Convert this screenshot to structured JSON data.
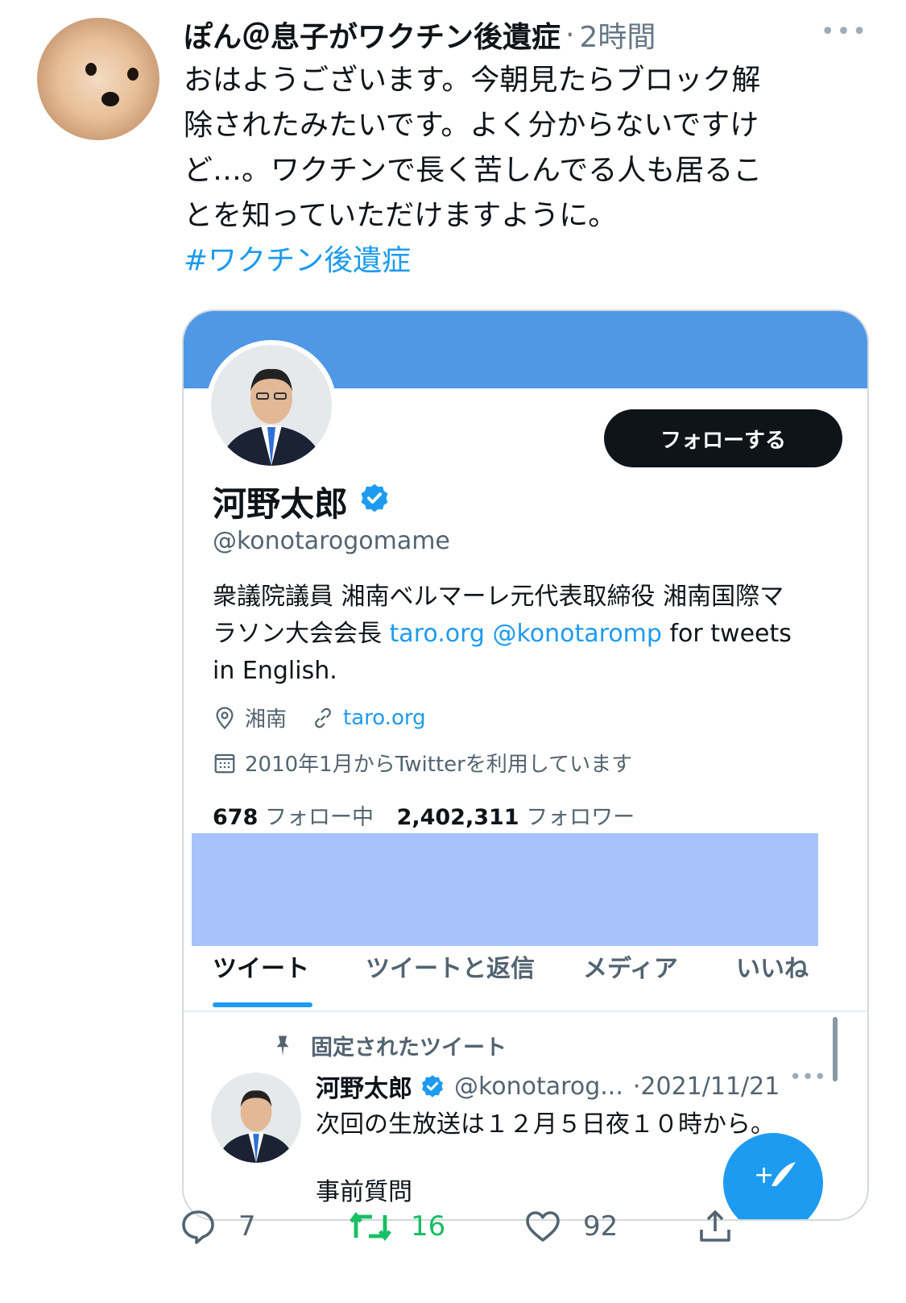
{
  "tweet": {
    "author_name": "ぽん＠息子がワクチン後遺症",
    "separator": "·",
    "time": "2時間",
    "text_lines": [
      "おはようございます。今朝見たらブロック解",
      "除されたみたいです。よく分からないですけ",
      "ど…。ワクチンで長く苦しんでる人も居るこ",
      "とを知っていただけますように。"
    ],
    "hashtag": "#ワクチン後遺症"
  },
  "card": {
    "follow_button": "フォローする",
    "name": "河野太郎",
    "handle": "@konotarogomame",
    "bio_lines": {
      "line1": "衆議院議員 湘南ベルマーレ元代表取締役 湘南国際マ",
      "line2_prefix": "ラソン大会会長 ",
      "line2_link1": "taro.org",
      "line2_link2": "@konotaromp",
      "line2_suffix": " for tweets",
      "line3": "in English."
    },
    "location": "湘南",
    "website": "taro.org",
    "joined": "2010年1月からTwitterを利用しています",
    "following_count": "678",
    "following_label": "フォロー中",
    "followers_count": "2,402,311",
    "followers_label": "フォロワー",
    "tabs": [
      "ツイート",
      "ツイートと返信",
      "メディア",
      "いいね"
    ],
    "pinned_label": "固定されたツイート",
    "pinned_tweet": {
      "name": "河野太郎",
      "handle": "@konotarog...",
      "date": "·2021/11/21",
      "text": "次回の生放送は１２月５日夜１０時から。",
      "text2": "事前質問"
    }
  },
  "actions": {
    "replies": "7",
    "retweets": "16",
    "likes": "92"
  },
  "colors": {
    "accent": "#1d9bf0",
    "banner": "#4f98e6",
    "highlight": "#a8c2fb",
    "retweet": "#17bf63"
  }
}
